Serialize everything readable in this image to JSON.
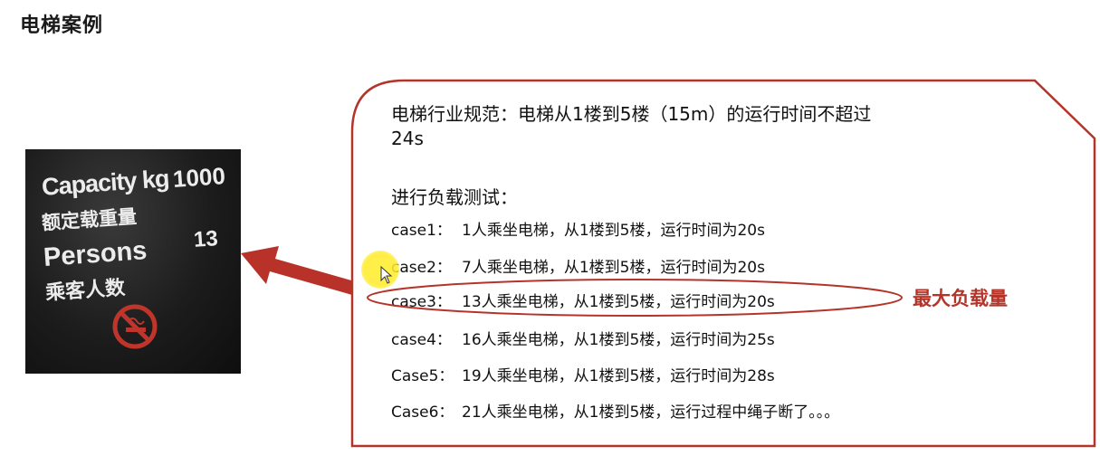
{
  "slide": {
    "title": "电梯案例"
  },
  "sign": {
    "capacity_label": "Capacity kg",
    "capacity_value": "1000",
    "capacity_cn": "额定载重量",
    "persons_label": "Persons",
    "persons_value": "13",
    "persons_cn": "乘客人数",
    "icon": "no-smoking-icon"
  },
  "callout": {
    "standard_line1": "电梯行业规范：电梯从1楼到5楼（15m）的运行时间不超过",
    "standard_line2": "24s",
    "test_heading": "进行负载测试：",
    "cases": [
      {
        "label": "case1：",
        "text": "1人乘坐电梯，从1楼到5楼，运行时间为20s"
      },
      {
        "label": "case2：",
        "text": "7人乘坐电梯，从1楼到5楼，运行时间为20s"
      },
      {
        "label": "case3：",
        "text": "13人乘坐电梯，从1楼到5楼，运行时间为20s"
      },
      {
        "label": "case4：",
        "text": "16人乘坐电梯，从1楼到5楼，运行时间为25s"
      },
      {
        "label": "Case5：",
        "text": "19人乘坐电梯，从1楼到5楼，运行时间为28s"
      },
      {
        "label": "Case6：",
        "text": "21人乘坐电梯，从1楼到5楼，运行过程中绳子断了。。。"
      }
    ],
    "highlight_note": "最大负载量"
  },
  "colors": {
    "accent": "#b4342a",
    "callout_border": "#b4342a",
    "arrow": "#b8322a"
  }
}
